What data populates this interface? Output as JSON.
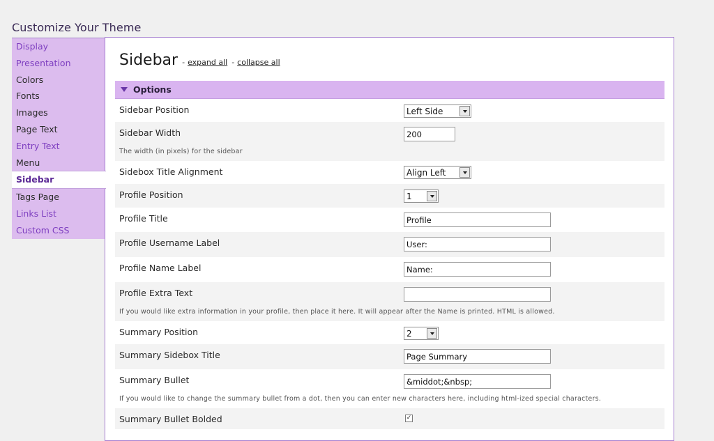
{
  "page_title": "Customize Your Theme",
  "nav": [
    {
      "label": "Display"
    },
    {
      "label": "Presentation"
    },
    {
      "label": "Colors"
    },
    {
      "label": "Fonts"
    },
    {
      "label": "Images"
    },
    {
      "label": "Page Text"
    },
    {
      "label": "Entry Text"
    },
    {
      "label": "Menu"
    },
    {
      "label": "Sidebar"
    },
    {
      "label": "Tags Page"
    },
    {
      "label": "Links List"
    },
    {
      "label": "Custom CSS"
    }
  ],
  "colors": {
    "accent": "#dcbcee",
    "accent_text": "#7e3fc0",
    "header": "#d9b4f0",
    "border": "#a67fd0"
  },
  "main": {
    "title": "Sidebar",
    "expand_all": "expand all",
    "collapse_all": "collapse all",
    "section_title": "Options",
    "section_icon": "triangle-down-icon",
    "fields": {
      "sidebar_position": {
        "label": "Sidebar Position",
        "value": "Left Side"
      },
      "sidebar_width": {
        "label": "Sidebar Width",
        "value": "200",
        "desc": "The width (in pixels) for the sidebar"
      },
      "sidebox_title_alignment": {
        "label": "Sidebox Title Alignment",
        "value": "Align Left"
      },
      "profile_position": {
        "label": "Profile Position",
        "value": "1"
      },
      "profile_title": {
        "label": "Profile Title",
        "value": "Profile"
      },
      "profile_username_label": {
        "label": "Profile Username Label",
        "value": "User:"
      },
      "profile_name_label": {
        "label": "Profile Name Label",
        "value": "Name:"
      },
      "profile_extra_text": {
        "label": "Profile Extra Text",
        "value": "",
        "desc": "If you would like extra information in your profile, then place it here. It will appear after the Name is printed. HTML is allowed."
      },
      "summary_position": {
        "label": "Summary Position",
        "value": "2"
      },
      "summary_sidebox_title": {
        "label": "Summary Sidebox Title",
        "value": "Page Summary"
      },
      "summary_bullet": {
        "label": "Summary Bullet",
        "value": "&middot;&nbsp;",
        "desc": "If you would like to change the summary bullet from a dot, then you can enter new characters here, including html-ized special characters."
      },
      "summary_bullet_bolded": {
        "label": "Summary Bullet Bolded",
        "checked_mark": "✓"
      }
    }
  }
}
